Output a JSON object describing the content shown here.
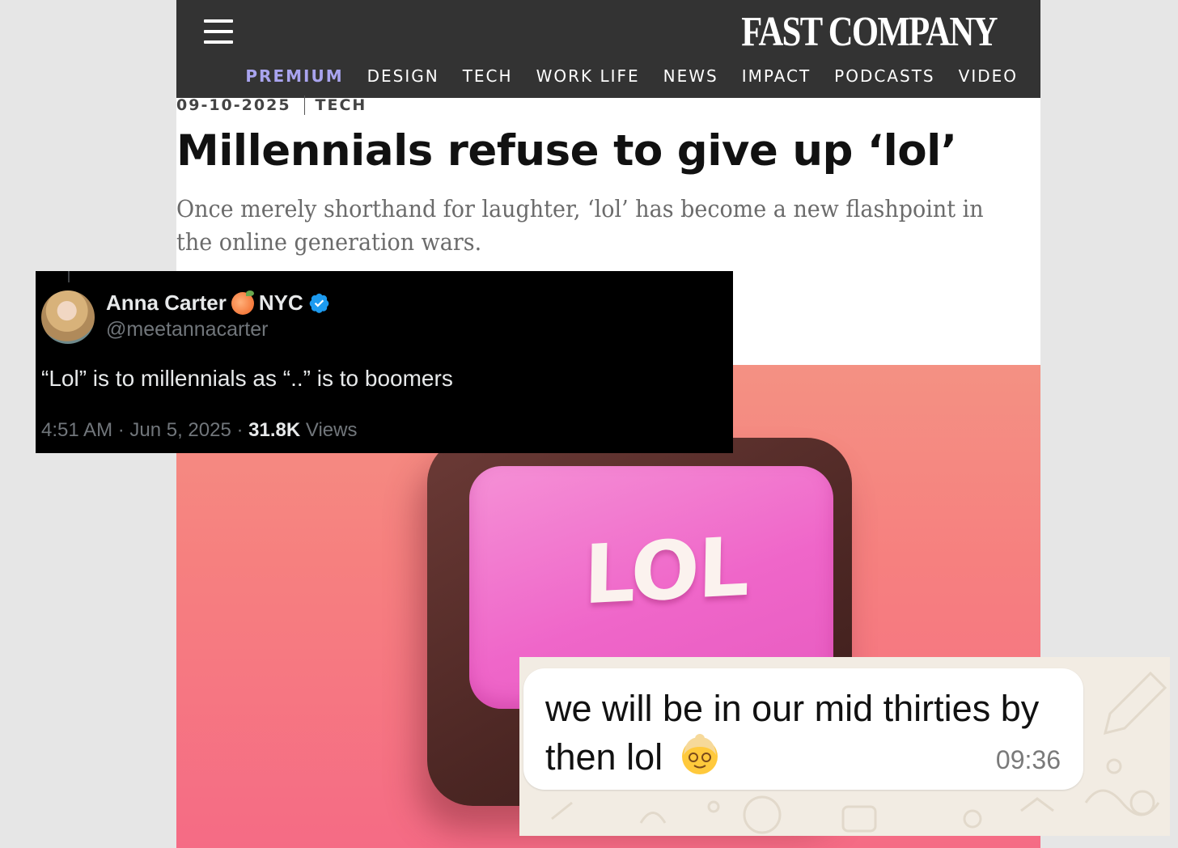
{
  "article": {
    "logo": "FAST COMPANY",
    "nav": [
      "PREMIUM",
      "DESIGN",
      "TECH",
      "WORK LIFE",
      "NEWS",
      "IMPACT",
      "PODCASTS",
      "VIDEO"
    ],
    "date": "09-10-2025",
    "category": "TECH",
    "headline": "Millennials refuse to give up ‘lol’",
    "dek": "Once merely shorthand for laughter, ‘lol’ has become a new flashpoint in the online generation wars.",
    "hero_keycap_label": "LOL",
    "colors": {
      "header_bg": "#333333",
      "premium": "#a9a4ef"
    }
  },
  "tweet": {
    "name": "Anna Carter",
    "location_suffix": "NYC",
    "name_emoji": "peach",
    "handle": "@meetannacarter",
    "text": "“Lol” is to millennials as “..” is to boomers",
    "time": "4:51 AM · Jun 5, 2025 · ",
    "views_count": "31.8K",
    "views_label": " Views",
    "verified_icon": "verified-badge-icon"
  },
  "chat": {
    "message": "we will be in our mid thirties by then lol",
    "emoji": "older-woman",
    "time": "09:36"
  }
}
